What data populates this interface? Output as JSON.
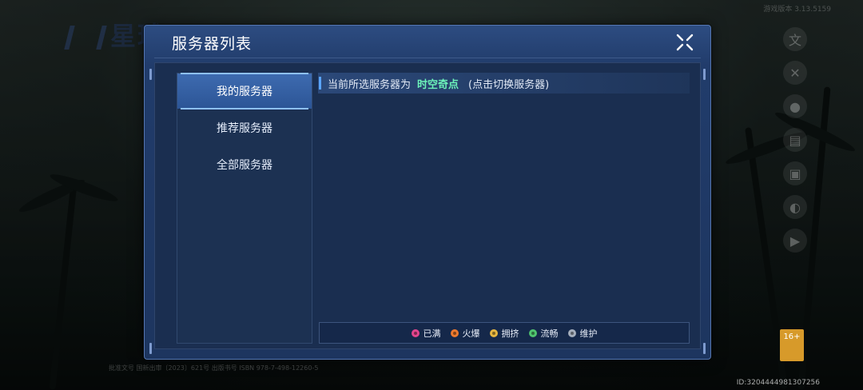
{
  "background": {
    "logo_text": "星球",
    "version_text": "游戏版本 3.13.5159",
    "footer_text": "批准文号  国新出审〔2023〕621号  出版书号  ISBN 978-7-498-12260-5",
    "rating_text": "16+",
    "device_id": "ID:3204444981307256"
  },
  "side_icons": [
    "translate-icon",
    "tools-icon",
    "user-icon",
    "notice-icon",
    "scan-icon",
    "message-icon",
    "video-icon"
  ],
  "modal": {
    "title": "服务器列表",
    "close_icon": "close-icon",
    "nav": [
      {
        "label": "我的服务器",
        "active": true
      },
      {
        "label": "推荐服务器",
        "active": false
      },
      {
        "label": "全部服务器",
        "active": false
      }
    ],
    "current": {
      "prefix": "当前所选服务器为",
      "server": "时空奇点",
      "hint": "(点击切换服务器)"
    },
    "legend": [
      {
        "label": "已满",
        "color": "#e2458d"
      },
      {
        "label": "火爆",
        "color": "#ee7a2e"
      },
      {
        "label": "拥挤",
        "color": "#e6b640"
      },
      {
        "label": "流畅",
        "color": "#4fc56f"
      },
      {
        "label": "维护",
        "color": "#a5aebb"
      }
    ]
  },
  "colors": {
    "accent": "#5aa4ff",
    "server_highlight": "#6cf2b9"
  }
}
